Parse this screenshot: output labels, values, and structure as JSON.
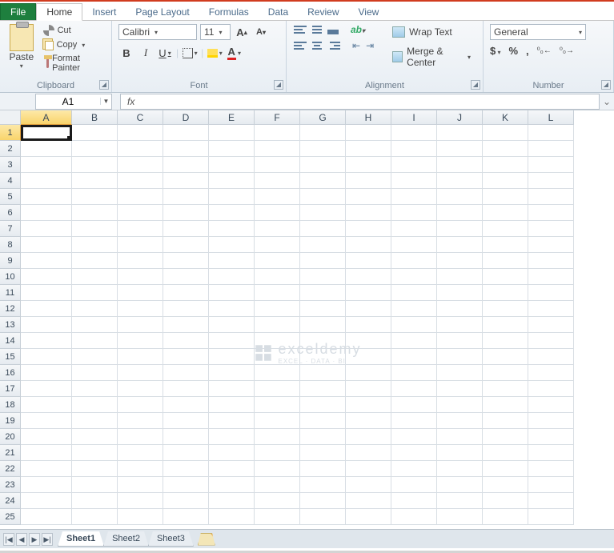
{
  "tabs": {
    "file": "File",
    "home": "Home",
    "insert": "Insert",
    "pagelayout": "Page Layout",
    "formulas": "Formulas",
    "data": "Data",
    "review": "Review",
    "view": "View"
  },
  "clipboard": {
    "paste": "Paste",
    "cut": "Cut",
    "copy": "Copy",
    "formatpainter": "Format Painter",
    "group": "Clipboard"
  },
  "font": {
    "name": "Calibri",
    "size": "11",
    "bold": "B",
    "italic": "I",
    "underline": "U",
    "grow": "A",
    "shrink": "A",
    "colorA": "A",
    "group": "Font"
  },
  "alignment": {
    "wrap": "Wrap Text",
    "merge": "Merge & Center",
    "group": "Alignment"
  },
  "number": {
    "format": "General",
    "currency": "$",
    "percent": "%",
    "comma": ",",
    "inc": ".0 .00",
    "dec": ".00 .0",
    "group": "Number"
  },
  "formulabar": {
    "namebox": "A1",
    "fx": "fx",
    "value": ""
  },
  "columns": [
    "A",
    "B",
    "C",
    "D",
    "E",
    "F",
    "G",
    "H",
    "I",
    "J",
    "K",
    "L"
  ],
  "rows": [
    "1",
    "2",
    "3",
    "4",
    "5",
    "6",
    "7",
    "8",
    "9",
    "10",
    "11",
    "12",
    "13",
    "14",
    "15",
    "16",
    "17",
    "18",
    "19",
    "20",
    "21",
    "22",
    "23",
    "24",
    "25"
  ],
  "selected": {
    "col": "A",
    "row": "1"
  },
  "sheets": {
    "s1": "Sheet1",
    "s2": "Sheet2",
    "s3": "Sheet3"
  },
  "nav": {
    "first": "|◀",
    "prev": "◀",
    "next": "▶",
    "last": "▶|"
  },
  "watermark": {
    "brand": "exceldemy",
    "sub": "EXCEL · DATA · BI"
  }
}
